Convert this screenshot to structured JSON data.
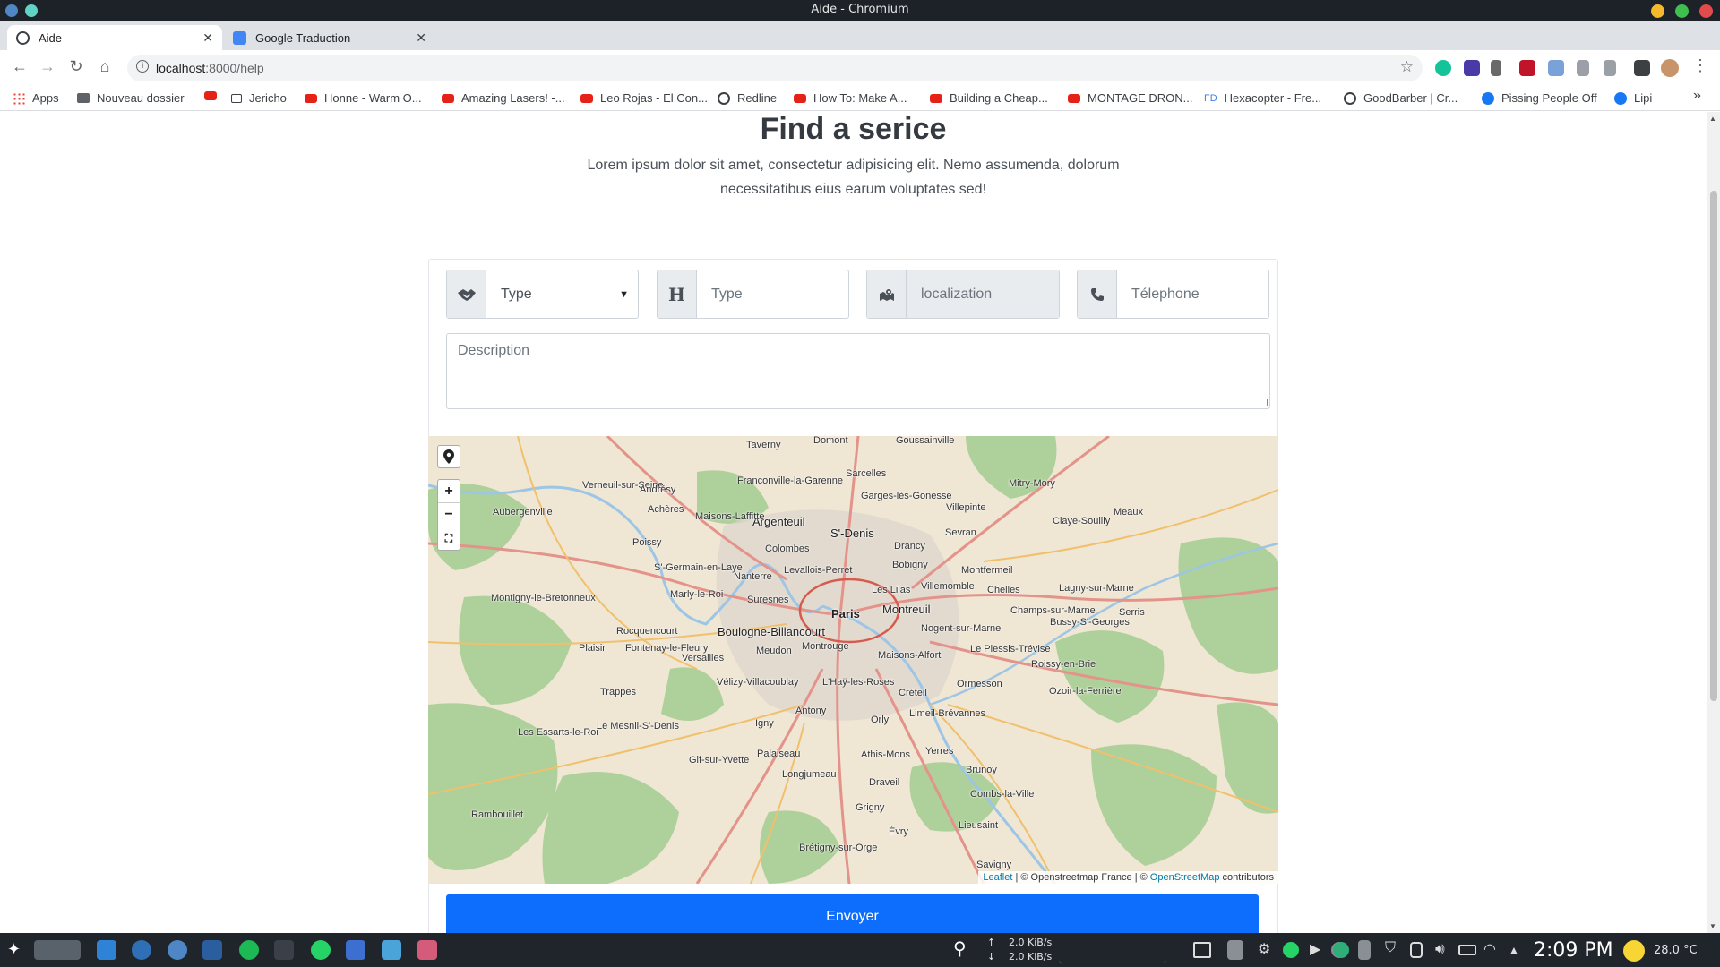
{
  "window": {
    "title": "Aide - Chromium"
  },
  "tabs": [
    {
      "label": "Aide",
      "active": true,
      "icon": "globe-icon"
    },
    {
      "label": "Google Traduction",
      "active": false,
      "icon": "google-translate-icon"
    }
  ],
  "address_bar": {
    "host": "localhost",
    "path": ":8000/help"
  },
  "bookmarks": [
    {
      "label": "Apps",
      "icon": "apps-grid-icon"
    },
    {
      "label": "Nouveau dossier",
      "icon": "folder-icon"
    },
    {
      "label": "Jericho",
      "icon": "page-icon"
    },
    {
      "label": "Honne - Warm O...",
      "icon": "youtube-icon"
    },
    {
      "label": "Amazing Lasers! -...",
      "icon": "youtube-icon"
    },
    {
      "label": "Leo Rojas - El Con...",
      "icon": "youtube-icon"
    },
    {
      "label": "Redline",
      "icon": "globe-icon"
    },
    {
      "label": "How To: Make A...",
      "icon": "youtube-icon"
    },
    {
      "label": "Building a Cheap...",
      "icon": "youtube-icon"
    },
    {
      "label": "MONTAGE DRON...",
      "icon": "youtube-icon"
    },
    {
      "label": "Hexacopter - Fre...",
      "icon": "fd-icon"
    },
    {
      "label": "GoodBarber | Cr...",
      "icon": "globe-icon"
    },
    {
      "label": "Pissing People Off",
      "icon": "facebook-icon"
    },
    {
      "label": "Lipi",
      "icon": "facebook-icon"
    }
  ],
  "bookmarks_more": "»",
  "fd_badge": "FD",
  "page": {
    "title": "Find a serice",
    "lead": "Lorem ipsum dolor sit amet, consectetur adipisicing elit. Nemo assumenda, dolorum necessitatibus eius earum voluptates sed!",
    "type_select": {
      "value": "Type",
      "icon": "handshake-icon"
    },
    "type_input": {
      "placeholder": "Type",
      "icon_text": "H"
    },
    "localization_input": {
      "placeholder": "localization",
      "icon": "map-marker-icon"
    },
    "phone_input": {
      "placeholder": "Télephone",
      "icon": "phone-icon"
    },
    "description": {
      "placeholder": "Description"
    },
    "submit_label": "Envoyer"
  },
  "map": {
    "zoom_in": "+",
    "zoom_out": "−",
    "attribution": {
      "leaflet": "Leaflet",
      "osm_france": "| © Openstreetmap France | ©",
      "osm": "OpenStreetMap",
      "contributors": "contributors"
    },
    "places": [
      "Paris",
      "Boulogne-Billancourt",
      "Argenteuil",
      "S'-Denis",
      "Montreuil",
      "Taverny",
      "Domont",
      "Goussainville",
      "Sarcelles",
      "Franconville-la-Garenne",
      "Garges-lès-Gonesse",
      "Villepinte",
      "Mitry-Mory",
      "Aubergenville",
      "Verneuil-sur-Seine",
      "Andrésy",
      "Achères",
      "Maisons-Laffitte",
      "Poissy",
      "Colombes",
      "Sevran",
      "Drancy",
      "Bobigny",
      "Nanterre",
      "Levallois-Perret",
      "S'-Germain-en-Laye",
      "Marly-le-Roi",
      "Suresnes",
      "Les Lilas",
      "Villemomble",
      "Montfermeil",
      "Chelles",
      "Claye-Souilly",
      "Meaux",
      "Lagny-sur-Marne",
      "Champs-sur-Marne",
      "Bussy-S'-Georges",
      "Serris",
      "Nogent-sur-Marne",
      "Rocquencourt",
      "Plaisir",
      "Fontenay-le-Fleury",
      "Versailles",
      "Meudon",
      "Montrouge",
      "Maisons-Alfort",
      "Le Plessis-Trévise",
      "Roissy-en-Brie",
      "Ozoir-la-Ferrière",
      "Trappes",
      "Vélizy-Villacoublay",
      "L'Haÿ-les-Roses",
      "Créteil",
      "Ormesson",
      "Antony",
      "Orly",
      "Limeil-Brévannes",
      "Igny",
      "Palaiseau",
      "Athis-Mons",
      "Yerres",
      "Brunoy",
      "Gif-sur-Yvette",
      "Longjumeau",
      "Draveil",
      "Combs-la-Ville",
      "Grigny",
      "Rambouillet",
      "Évry",
      "Lieusaint",
      "Brétigny-sur-Orge",
      "Savigny",
      "Montigny-le-Bretonneux",
      "Les Essarts-le-Roi",
      "Le Mesnil-S'-Denis"
    ]
  },
  "taskbar": {
    "net_up": "2.0 KiB/s",
    "net_down": "2.0 KiB/s",
    "clock": "2:09 PM",
    "temperature": "28.0 °C"
  }
}
